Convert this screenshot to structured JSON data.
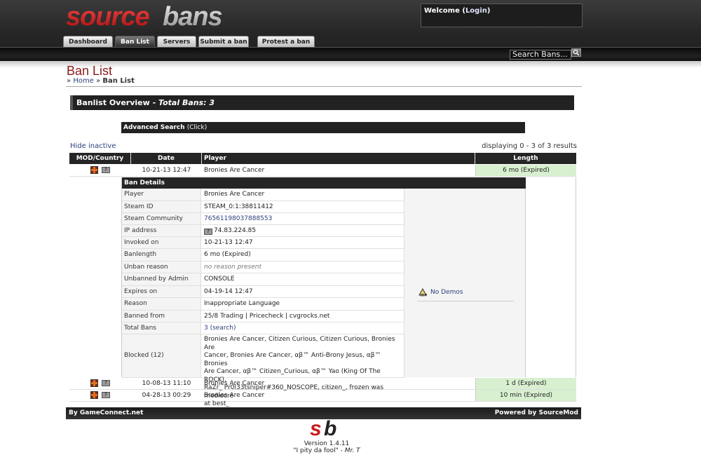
{
  "header": {
    "logo_text": "sourcebans",
    "welcome_prefix": "Welcome (",
    "welcome_login": "Login",
    "welcome_suffix": ")",
    "search_placeholder": "Search Bans...",
    "tabs": [
      {
        "label": "Dashboard",
        "active": false
      },
      {
        "label": "Ban List",
        "active": true
      },
      {
        "label": "Servers",
        "active": false
      },
      {
        "label": "Submit a ban",
        "active": false
      },
      {
        "label": "Protest a ban",
        "active": false
      }
    ]
  },
  "page": {
    "title": "Ban List",
    "breadcrumb": {
      "sep": "»",
      "home": "Home",
      "current": "Ban List"
    },
    "overview_prefix": "Banlist Overview - ",
    "overview_total": "Total Bans: 3",
    "advanced_search": "Advanced Search",
    "advanced_click": "(Click)",
    "hide_inactive": "Hide inactive",
    "displaying": "displaying 0 - 3 of 3 results"
  },
  "table": {
    "headers": {
      "mod": "MOD/Country",
      "date": "Date",
      "player": "Player",
      "length": "Length"
    },
    "rows": [
      {
        "date": "10-21-13 12:47",
        "player": "Bronies Are Cancer",
        "length": "6 mo (Expired)"
      },
      {
        "date": "10-08-13 11:10",
        "player": "Bronies Are Cancer",
        "length": "1 d (Expired)"
      },
      {
        "date": "04-28-13 00:29",
        "player": "Bronies Are Cancer",
        "length": "10 min (Expired)"
      }
    ]
  },
  "details": {
    "header": "Ban Details",
    "player_label": "Player",
    "player": "Bronies Are Cancer",
    "steamid_label": "Steam ID",
    "steamid": "STEAM_0:1:38811412",
    "community_label": "Steam Community",
    "community": "76561198037888553",
    "ip_label": "IP address",
    "ip": "74.83.224.85",
    "invoked_label": "Invoked on",
    "invoked": "10-21-13 12:47",
    "banlength_label": "Banlength",
    "banlength": "6 mo (Expired)",
    "unban_reason_label": "Unban reason",
    "unban_reason": "no reason present",
    "unbanned_by_label": "Unbanned by Admin",
    "unbanned_by": "CONSOLE",
    "expires_label": "Expires on",
    "expires": "04-19-14 12:47",
    "reason_label": "Reason",
    "reason": "Inappropriate Language",
    "banned_from_label": "Banned from",
    "banned_from": "25/8 Trading | Pricecheck | cvgrocks.net",
    "total_bans_label": "Total Bans",
    "total_bans": "3 (search)",
    "blocked_label": "Blocked (12)",
    "blocked_lines": [
      "Bronies Are Cancer, Citizen Curious, Citizen Curious, Bronies Are",
      "Cancer, Bronies Are Cancer, αβ™ Anti-Brony Jesus, αβ™ Bronies",
      "Are Cancer, αβ™ Citizen_Curious, αβ™ Yao (King Of The ROCK),",
      "RaZr_ Pr0l33tsniper#360_NOSCOPE, citizen_, frozen was mediocre",
      "at best_"
    ],
    "demos": "No Demos"
  },
  "footer": {
    "left": "By GameConnect.net",
    "right": "Powered by SourceMod",
    "version": "Version 1.4.11",
    "quote": "\"I pity da fool\" - ",
    "quote_author": "Mr. T"
  },
  "colors": {
    "title_red": "#8b1a1a",
    "link_blue": "#2c3e7a",
    "expired_green": "#d8f0d0",
    "bar_dark": "#222222"
  }
}
